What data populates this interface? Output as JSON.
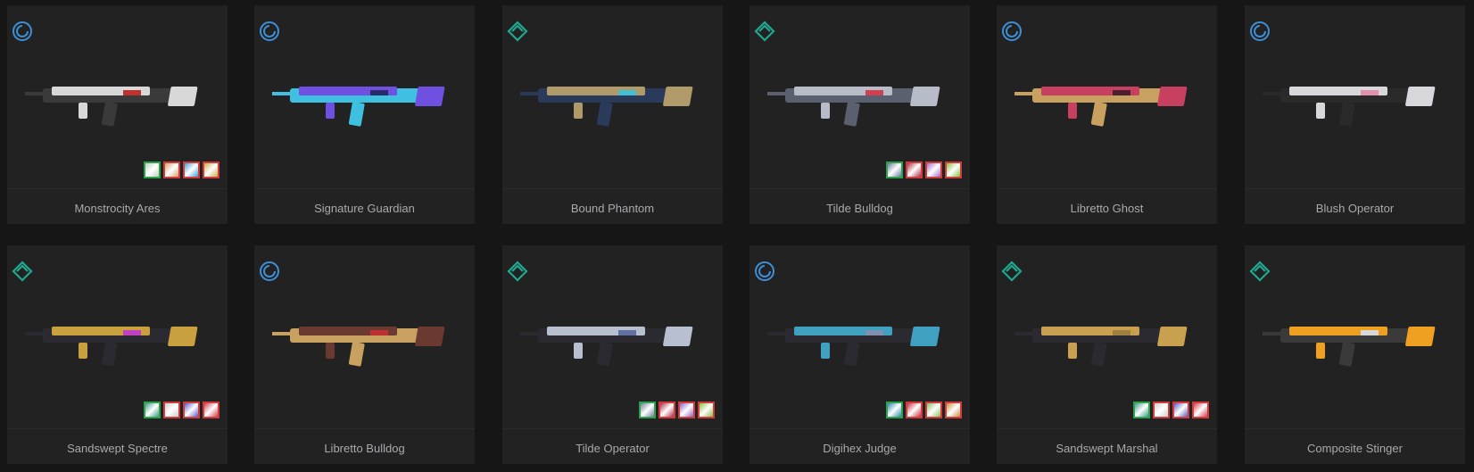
{
  "colors": {
    "background": "#161617",
    "card": "#222223",
    "name_text": "#a9a9ab",
    "tier_blue": "#3d8fd6",
    "tier_teal": "#1ea88d"
  },
  "skins": [
    {
      "name": "Monstrocity Ares",
      "tier_icon": "tier-blue-ring-icon",
      "weapon_icon": "ares-icon",
      "chromas": [
        "#c0d0c0",
        "#d8a26a",
        "#3fa0d8",
        "#c8b04a"
      ]
    },
    {
      "name": "Signature Guardian",
      "tier_icon": "tier-blue-ring-icon",
      "weapon_icon": "guardian-icon",
      "chromas": []
    },
    {
      "name": "Bound Phantom",
      "tier_icon": "tier-teal-diamond-icon",
      "weapon_icon": "phantom-icon",
      "chromas": []
    },
    {
      "name": "Tilde Bulldog",
      "tier_icon": "tier-teal-diamond-icon",
      "weapon_icon": "bulldog-icon",
      "chromas": [
        "#6a7aa0",
        "#b0304a",
        "#a070c8",
        "#88c040"
      ]
    },
    {
      "name": "Libretto Ghost",
      "tier_icon": "tier-blue-ring-icon",
      "weapon_icon": "ghost-icon",
      "chromas": []
    },
    {
      "name": "Blush Operator",
      "tier_icon": "tier-blue-ring-icon",
      "weapon_icon": "operator-icon",
      "chromas": []
    },
    {
      "name": "Sandswept Spectre",
      "tier_icon": "tier-teal-diamond-icon",
      "weapon_icon": "spectre-icon",
      "chromas": [
        "#3f9a8a",
        "#d0d0d0",
        "#5a5ac8",
        "#d04050"
      ]
    },
    {
      "name": "Libretto Bulldog",
      "tier_icon": "tier-blue-ring-icon",
      "weapon_icon": "bulldog-icon",
      "chromas": []
    },
    {
      "name": "Tilde Operator",
      "tier_icon": "tier-teal-diamond-icon",
      "weapon_icon": "operator-icon",
      "chromas": [
        "#7080a0",
        "#b0304a",
        "#9060c8",
        "#88c040"
      ]
    },
    {
      "name": "Digihex Judge",
      "tier_icon": "tier-blue-ring-icon",
      "weapon_icon": "judge-icon",
      "chromas": [
        "#2a8ab0",
        "#c83040",
        "#88c060",
        "#c89040"
      ]
    },
    {
      "name": "Sandswept Marshal",
      "tier_icon": "tier-teal-diamond-icon",
      "weapon_icon": "marshal-icon",
      "chromas": [
        "#3f9a8a",
        "#d0d0d0",
        "#5a5ac8",
        "#d04050"
      ]
    },
    {
      "name": "Composite Stinger",
      "tier_icon": "tier-teal-diamond-icon",
      "weapon_icon": "stinger-icon",
      "chromas": []
    }
  ]
}
